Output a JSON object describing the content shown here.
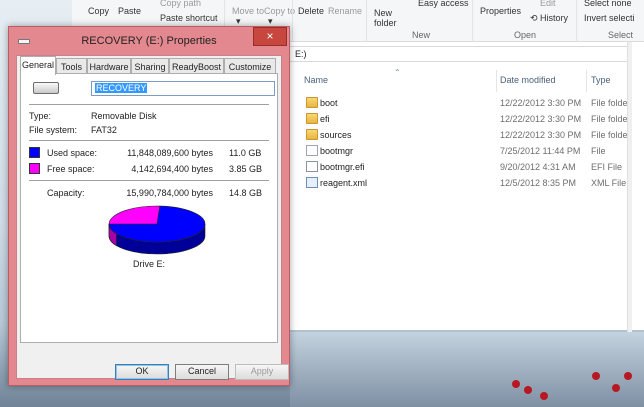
{
  "ribbon": {
    "copy": "Copy",
    "paste": "Paste",
    "copy_path": "Copy path",
    "paste_shortcut": "Paste shortcut",
    "move_to": "Move to",
    "copy_to": "Copy to",
    "organize": "anize",
    "delete": "Delete",
    "rename": "Rename",
    "new_folder": "New folder",
    "new_group": "New",
    "easy_access": "Easy access",
    "properties": "Properties",
    "edit": "Edit",
    "history": "History",
    "open_group": "Open",
    "select_none": "Select none",
    "invert_selection": "Invert selecti",
    "select_group": "Select"
  },
  "address": {
    "text": "E:)"
  },
  "file_list": {
    "columns": {
      "name": "Name",
      "date": "Date modified",
      "type": "Type"
    },
    "rows": [
      {
        "name": "boot",
        "date": "12/22/2012 3:30 PM",
        "type": "File folder",
        "icon": "folder-icon"
      },
      {
        "name": "efi",
        "date": "12/22/2012 3:30 PM",
        "type": "File folder",
        "icon": "folder-icon"
      },
      {
        "name": "sources",
        "date": "12/22/2012 3:30 PM",
        "type": "File folder",
        "icon": "folder-icon"
      },
      {
        "name": "bootmgr",
        "date": "7/25/2012 11:44 PM",
        "type": "File",
        "icon": "file-icon"
      },
      {
        "name": "bootmgr.efi",
        "date": "9/20/2012 4:31 AM",
        "type": "EFI File",
        "icon": "efi-file-icon"
      },
      {
        "name": "reagent.xml",
        "date": "12/5/2012 8:35 PM",
        "type": "XML File",
        "icon": "xml-file-icon"
      }
    ]
  },
  "dialog": {
    "title": "RECOVERY (E:) Properties",
    "tabs": [
      "General",
      "Tools",
      "Hardware",
      "Sharing",
      "ReadyBoost",
      "Customize"
    ],
    "active_tab": "General",
    "volume_name": "RECOVERY",
    "type_label": "Type:",
    "type_value": "Removable Disk",
    "fs_label": "File system:",
    "fs_value": "FAT32",
    "used_label": "Used space:",
    "used_bytes": "11,848,089,600 bytes",
    "used_size": "11.0 GB",
    "free_label": "Free space:",
    "free_bytes": "4,142,694,400 bytes",
    "free_size": "3.85 GB",
    "capacity_label": "Capacity:",
    "capacity_bytes": "15,990,784,000 bytes",
    "capacity_size": "14.8 GB",
    "drive_label": "Drive E:",
    "used_fraction": 0.741,
    "used_color": "#0000ff",
    "free_color": "#ff00ff",
    "buttons": {
      "ok": "OK",
      "cancel": "Cancel",
      "apply": "Apply"
    },
    "close": "×"
  },
  "colors": {
    "dialog_frame": "#e48890",
    "close_button": "#c7463d",
    "selection": "#3399ff"
  }
}
